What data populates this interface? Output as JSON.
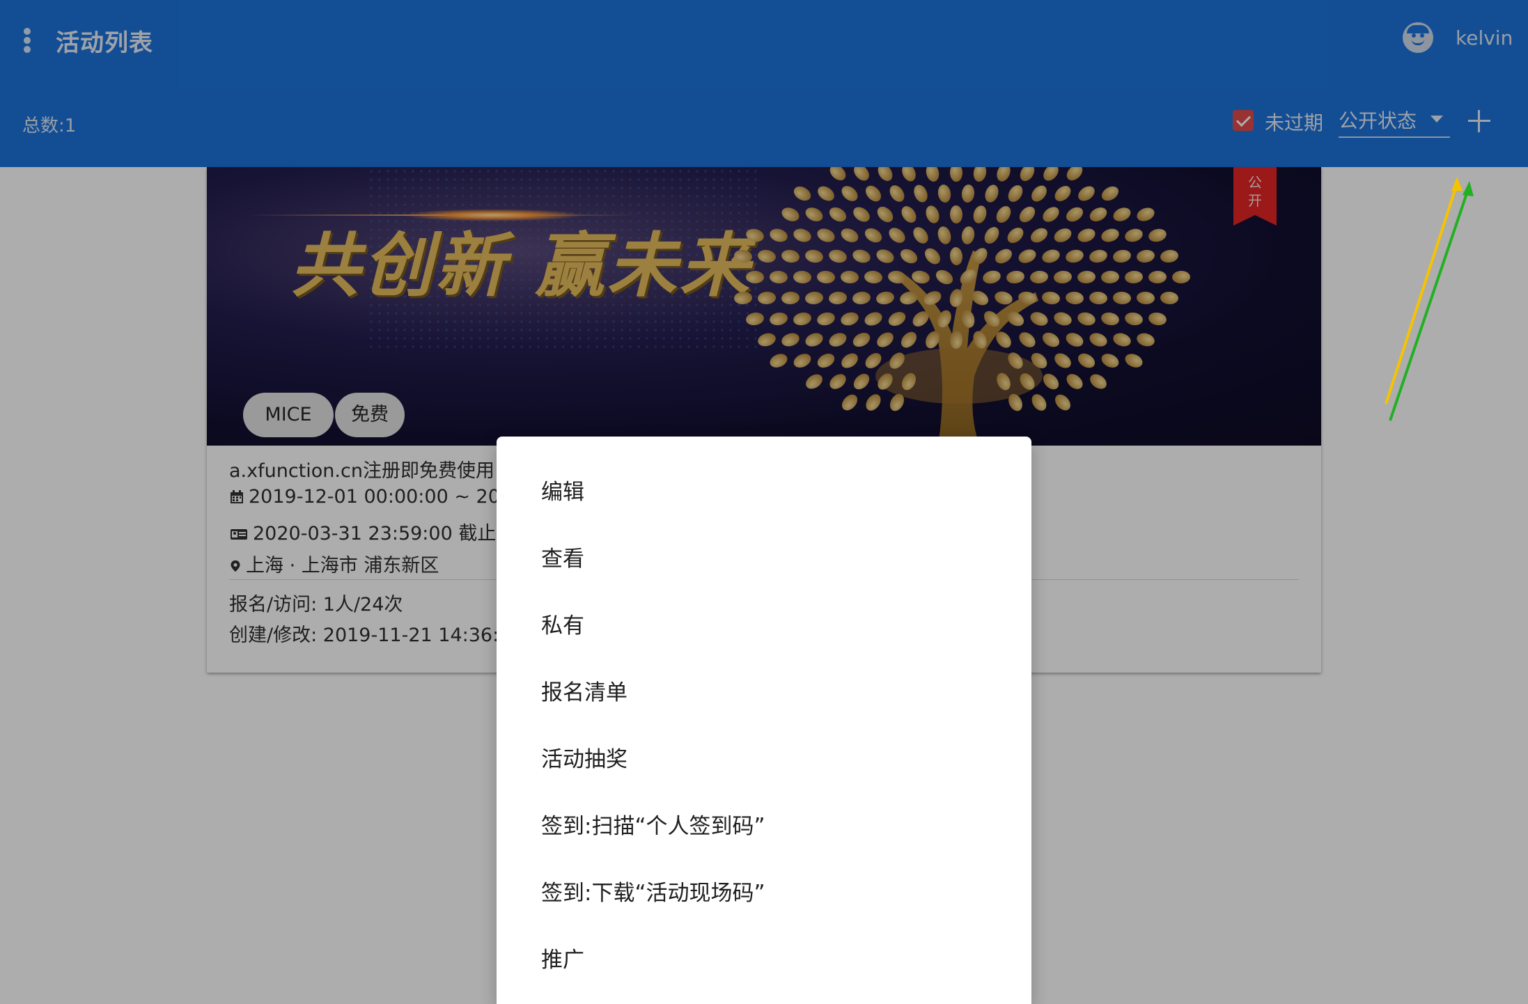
{
  "appbar": {
    "title": "活动列表",
    "username": "kelvin",
    "total_label": "总数:1",
    "filter_checkbox_label": "未过期",
    "filter_checkbox_checked": true,
    "status_select_value": "公开状态"
  },
  "icons": {
    "menu": "more-vertical-icon",
    "avatar": "user-face-icon",
    "add": "plus-icon",
    "dropdown": "caret-down-icon",
    "calendar": "calendar-icon",
    "id_card": "id-card-icon",
    "location": "location-pin-icon"
  },
  "colors": {
    "appbar": "#1c74dc",
    "checkbox": "#e24a4a",
    "ribbon": "#e52525",
    "annotation_yellow": "#f6c300",
    "annotation_green": "#22b022"
  },
  "card": {
    "banner_slogan": "共创新 赢未来",
    "badge_line1": "公",
    "badge_line2": "开",
    "chips": [
      "MICE",
      "免费"
    ],
    "description": "a.xfunction.cn注册即免费使用 |",
    "date_range": "2019-12-01 00:00:00 ~ 2020-",
    "deadline": "2020-03-31 23:59:00 截止",
    "location": "上海 · 上海市 浦东新区",
    "stats": "报名/访问:  1人/24次",
    "created_modified": "创建/修改:  2019-11-21 14:36:1"
  },
  "menu": {
    "items": [
      "编辑",
      "查看",
      "私有",
      "报名清单",
      "活动抽奖",
      "签到:扫描“个人签到码”",
      "签到:下载“活动现场码”",
      "推广"
    ]
  }
}
